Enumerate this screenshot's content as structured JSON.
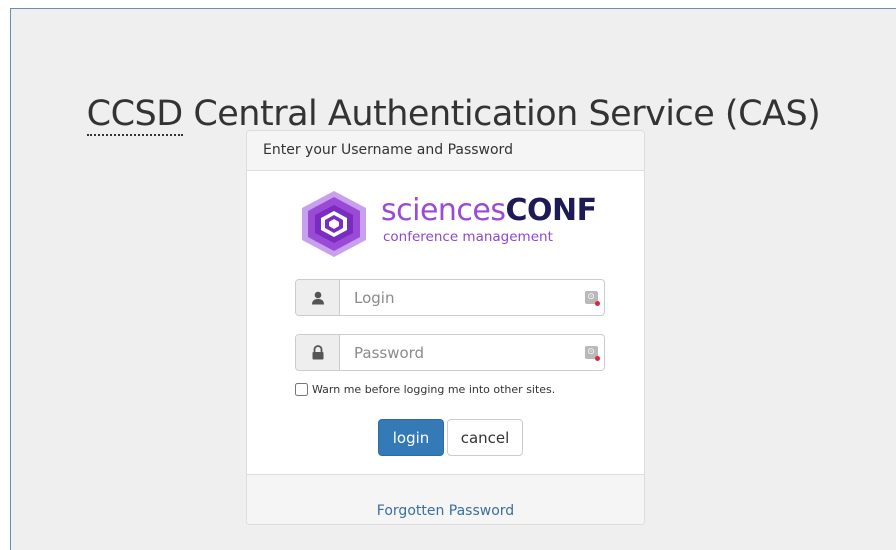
{
  "page": {
    "title_abbr": "CCSD",
    "title_rest": " Central Authentication Service (CAS)"
  },
  "panel": {
    "heading": "Enter your Username and Password"
  },
  "logo": {
    "brand_light": "sciences",
    "brand_bold": "CONF",
    "tagline": "conference management",
    "colors": {
      "purple": "#9b4ad6",
      "navy": "#1d1a55"
    }
  },
  "form": {
    "login_placeholder": "Login",
    "password_placeholder": "Password",
    "login_icon": "user-icon",
    "password_icon": "lock-icon",
    "warn_label": "Warn me before logging me into other sites.",
    "login_button": "login",
    "cancel_button": "cancel"
  },
  "footer": {
    "forgot_link": "Forgotten Password"
  },
  "colors": {
    "primary": "#337ab7",
    "link": "#3a6fa0",
    "background": "#efefef"
  }
}
